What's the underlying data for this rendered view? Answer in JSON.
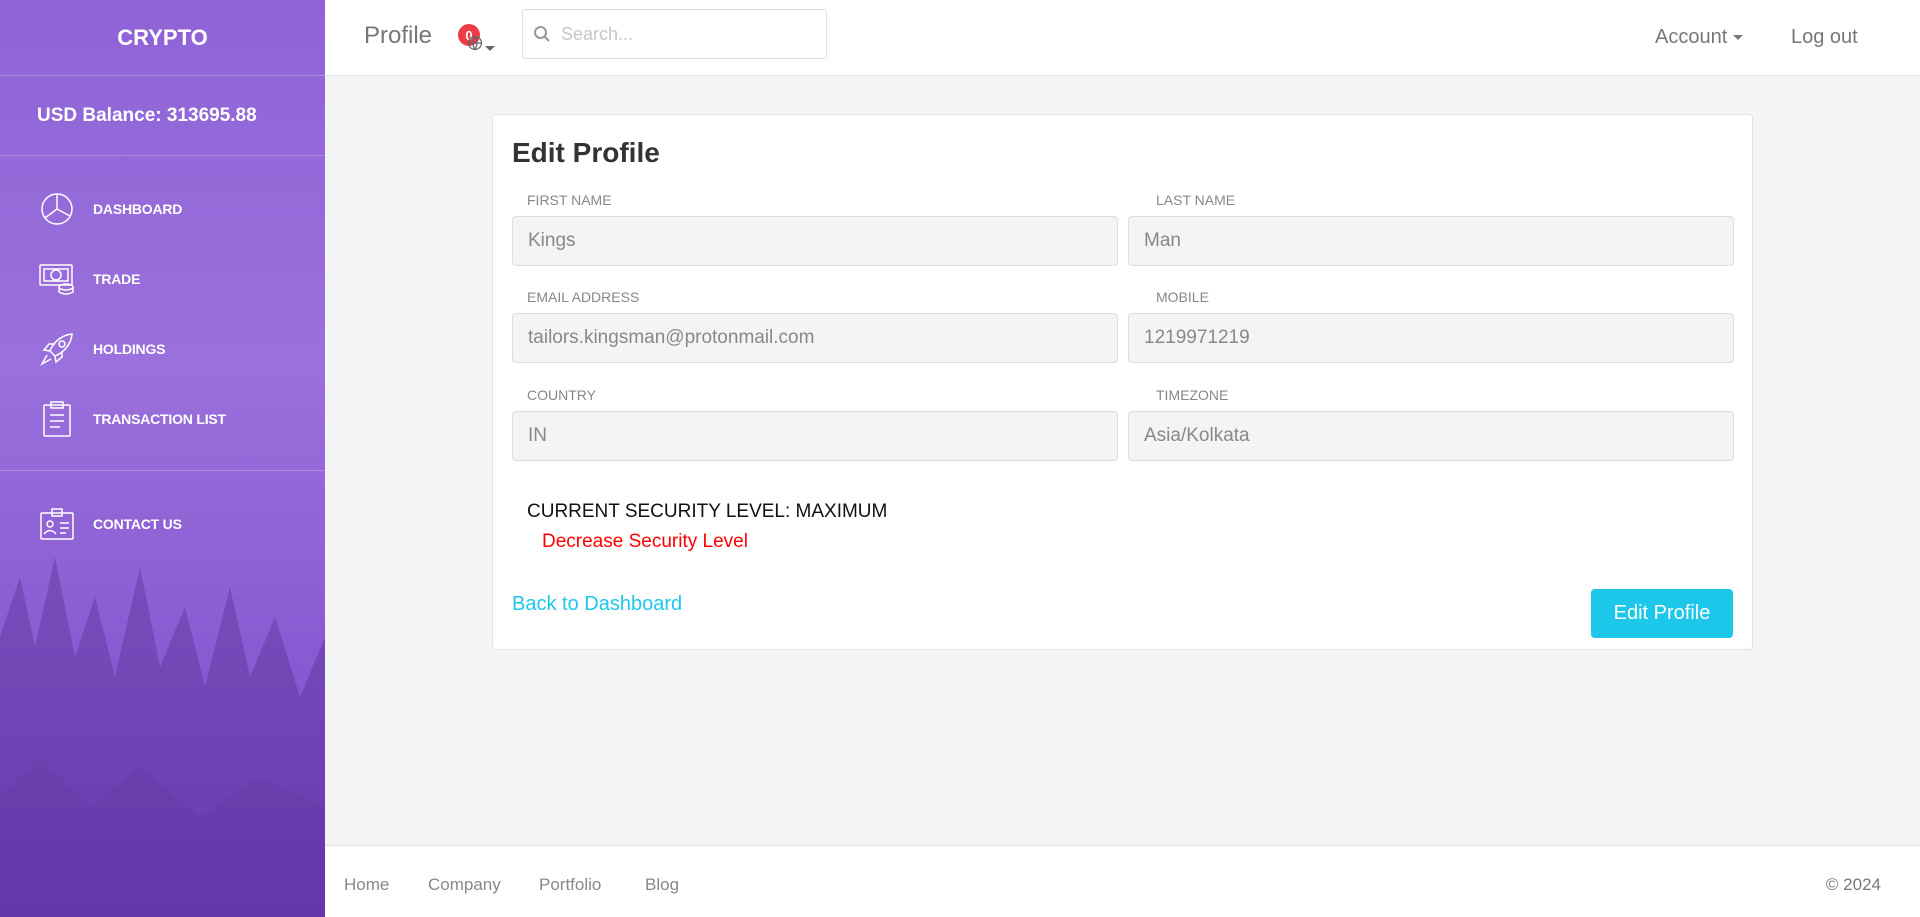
{
  "sidebar": {
    "brand": "CRYPTO",
    "balance": "USD Balance: 313695.88",
    "items": [
      {
        "label": "DASHBOARD",
        "icon": "pie-chart-icon"
      },
      {
        "label": "TRADE",
        "icon": "money-icon"
      },
      {
        "label": "HOLDINGS",
        "icon": "rocket-icon"
      },
      {
        "label": "TRANSACTION LIST",
        "icon": "clipboard-icon"
      }
    ],
    "secondary": [
      {
        "label": "CONTACT US",
        "icon": "id-card-icon"
      }
    ]
  },
  "header": {
    "title": "Profile",
    "notification_count": "0",
    "search_placeholder": "Search...",
    "account_label": "Account",
    "logout_label": "Log out"
  },
  "profile_form": {
    "title": "Edit Profile",
    "first_name": {
      "label": "First Name",
      "value": "Kings"
    },
    "last_name": {
      "label": "Last Name",
      "value": "Man"
    },
    "email": {
      "label": "Email Address",
      "value": "tailors.kingsman@protonmail.com"
    },
    "mobile": {
      "label": "Mobile",
      "value": "1219971219"
    },
    "country": {
      "label": "Country",
      "value": "IN"
    },
    "timezone": {
      "label": "Timezone",
      "value": "Asia/Kolkata"
    },
    "security_level": "CURRENT SECURITY LEVEL: MAXIMUM",
    "decrease_security": "Decrease Security Level",
    "back_link": "Back to Dashboard",
    "submit_label": "Edit Profile"
  },
  "footer": {
    "links": [
      "Home",
      "Company",
      "Portfolio",
      "Blog"
    ],
    "copyright": "© 2024"
  },
  "colors": {
    "accent": "#1dc7ea",
    "sidebar": "#8f63d6",
    "danger": "#ff0000",
    "badge": "#ef3b45"
  }
}
